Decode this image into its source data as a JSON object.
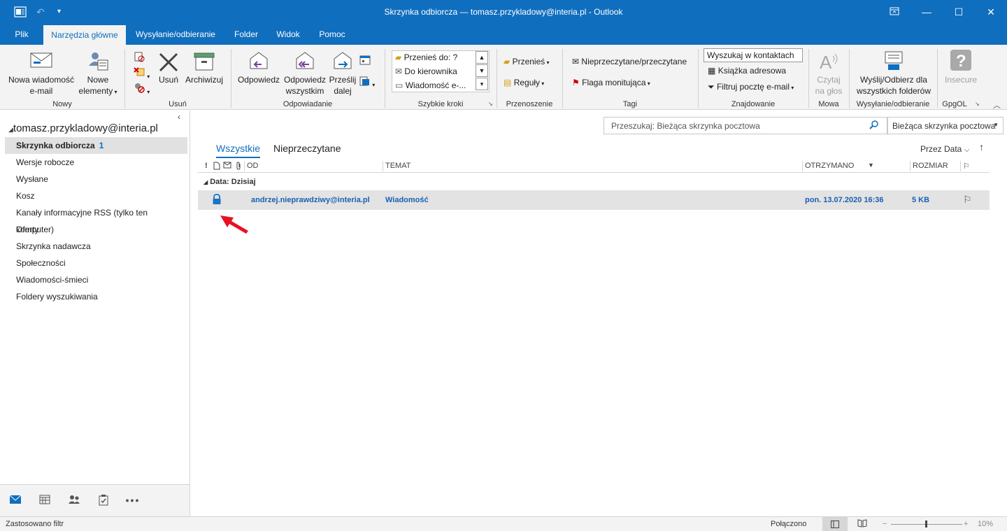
{
  "window": {
    "title": "Skrzynka odbiorcza — tomasz.przykladowy@interia.pl  -  Outlook",
    "minimize": "—",
    "maximize": "☐",
    "close": "✕"
  },
  "menu": {
    "tabs": [
      "Plik",
      "Narzędzia główne",
      "Wysyłanie/odbieranie",
      "Folder",
      "Widok",
      "Pomoc"
    ],
    "active": "Narzędzia główne"
  },
  "ribbon": {
    "groups": {
      "nowy": {
        "label": "Nowy",
        "new_email": [
          "Nowa wiadomość",
          "e-mail"
        ],
        "new_items": [
          "Nowe",
          "elementy"
        ]
      },
      "usun": {
        "label": "Usuń",
        "delete": "Usuń",
        "archive": "Archiwizuj"
      },
      "odpowiadanie": {
        "label": "Odpowiadanie",
        "reply": "Odpowiedz",
        "reply_all": [
          "Odpowiedz",
          "wszystkim"
        ],
        "forward": [
          "Prześlij",
          "dalej"
        ]
      },
      "szybkie_kroki": {
        "label": "Szybkie kroki",
        "items": [
          "Przenieś do: ?",
          "Do kierownika",
          "Wiadomość e-..."
        ]
      },
      "przenoszenie": {
        "label": "Przenoszenie",
        "move": "Przenieś",
        "rules": "Reguły"
      },
      "tagi": {
        "label": "Tagi",
        "unread_read": "Nieprzeczytane/przeczytane",
        "followup": "Flaga monitująca"
      },
      "znajdowanie": {
        "label": "Znajdowanie",
        "search_contacts": "Wyszukaj w kontaktach",
        "address_book": "Książka adresowa",
        "filter_email": "Filtruj pocztę e-mail"
      },
      "mowa": {
        "label": "Mowa",
        "read_aloud": [
          "Czytaj",
          "na głos"
        ]
      },
      "wysylanie": {
        "label": "Wysyłanie/odbieranie",
        "send_receive_all": [
          "Wyślij/Odbierz dla",
          "wszystkich folderów"
        ]
      },
      "gpgol": {
        "label": "GpgOL",
        "insecure": "Insecure"
      }
    }
  },
  "sidebar": {
    "account": "tomasz.przykladowy@interia.pl",
    "folders": [
      {
        "name": "Skrzynka odbiorcza",
        "count": "1",
        "selected": true
      },
      {
        "name": "Wersje robocze",
        "count": "",
        "selected": false
      },
      {
        "name": "Wysłane",
        "count": "",
        "selected": false
      },
      {
        "name": "Kosz",
        "count": "",
        "selected": false
      },
      {
        "name": "Kanały informacyjne RSS (tylko ten komputer)",
        "count": "",
        "selected": false
      },
      {
        "name": "Oferty",
        "count": "",
        "selected": false
      },
      {
        "name": "Skrzynka nadawcza",
        "count": "",
        "selected": false
      },
      {
        "name": "Społeczności",
        "count": "",
        "selected": false
      },
      {
        "name": "Wiadomości-śmieci",
        "count": "",
        "selected": false
      },
      {
        "name": "Foldery wyszukiwania",
        "count": "",
        "selected": false
      }
    ]
  },
  "main": {
    "search_placeholder": "Przeszukaj: Bieżąca skrzynka pocztowa",
    "scope": "Bieżąca skrzynka pocztowa",
    "view_tabs": [
      "Wszystkie",
      "Nieprzeczytane"
    ],
    "sort_label": "Przez Data",
    "columns": {
      "importance": "!",
      "from": "OD",
      "subject": "TEMAT",
      "received": "OTRZYMANO",
      "size": "ROZMIAR"
    },
    "group_header": "Data: Dzisiaj",
    "messages": [
      {
        "from": "andrzej.nieprawdziwy@interia.pl",
        "subject": "Wiadomość",
        "received": "pon. 13.07.2020 16:36",
        "size": "5 KB"
      }
    ]
  },
  "status": {
    "left": "Zastosowano filtr",
    "connection": "Połączono",
    "zoom": "10%"
  },
  "colors": {
    "accent": "#106ebe",
    "arrow": "#e81123"
  }
}
